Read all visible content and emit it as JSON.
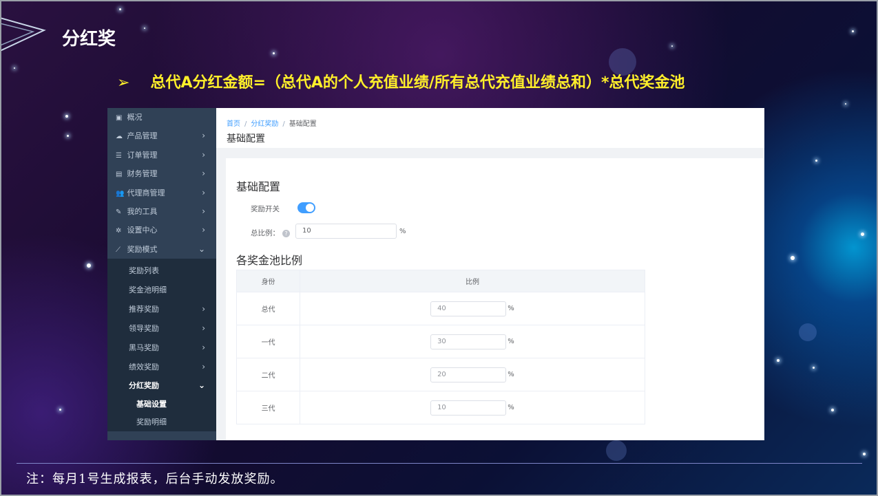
{
  "slide": {
    "title": "分红奖",
    "bullet": "➢",
    "formula": "总代A分红金额=（总代A的个人充值业绩/所有总代充值业绩总和）*总代奖金池",
    "note": "注：每月1号生成报表，后台手动发放奖励。"
  },
  "sidebar": {
    "items": [
      {
        "label": "概况",
        "icon": "dashboard-icon",
        "glyph": "▣"
      },
      {
        "label": "产品管理",
        "icon": "cloud-icon",
        "glyph": "☁"
      },
      {
        "label": "订单管理",
        "icon": "list-icon",
        "glyph": "☰"
      },
      {
        "label": "财务管理",
        "icon": "money-icon",
        "glyph": "▤"
      },
      {
        "label": "代理商管理",
        "icon": "users-icon",
        "glyph": "👥"
      },
      {
        "label": "我的工具",
        "icon": "wrench-icon",
        "glyph": "✎"
      },
      {
        "label": "设置中心",
        "icon": "gear-icon",
        "glyph": "✲"
      },
      {
        "label": "奖励模式",
        "icon": "chart-icon",
        "glyph": "⟋"
      }
    ],
    "reward_sub": [
      "奖励列表",
      "奖金池明细",
      "推荐奖励",
      "领导奖励",
      "黑马奖励",
      "绩效奖励",
      "分红奖励"
    ],
    "dividend_sub": [
      "基础设置",
      "奖励明细"
    ],
    "chevron_right": "›",
    "chevron_down": "⌄"
  },
  "breadcrumb": {
    "home": "首页",
    "section": "分红奖励",
    "current": "基础配置",
    "sep": "/"
  },
  "page_title": "基础配置",
  "config": {
    "section_title": "基础配置",
    "switch_label": "奖励开关",
    "switch_on": true,
    "ratio_label": "总比例：",
    "help_glyph": "?",
    "ratio_value": "10",
    "percent": "%"
  },
  "pool": {
    "section_title": "各奖金池比例",
    "columns": [
      "身份",
      "比例"
    ],
    "rows": [
      {
        "identity": "总代",
        "value": "40"
      },
      {
        "identity": "一代",
        "value": "30"
      },
      {
        "identity": "二代",
        "value": "20"
      },
      {
        "identity": "三代",
        "value": "10"
      }
    ]
  },
  "colors": {
    "accent": "#409eff",
    "sidebar_bg": "#304156",
    "formula": "#ffef2a"
  }
}
